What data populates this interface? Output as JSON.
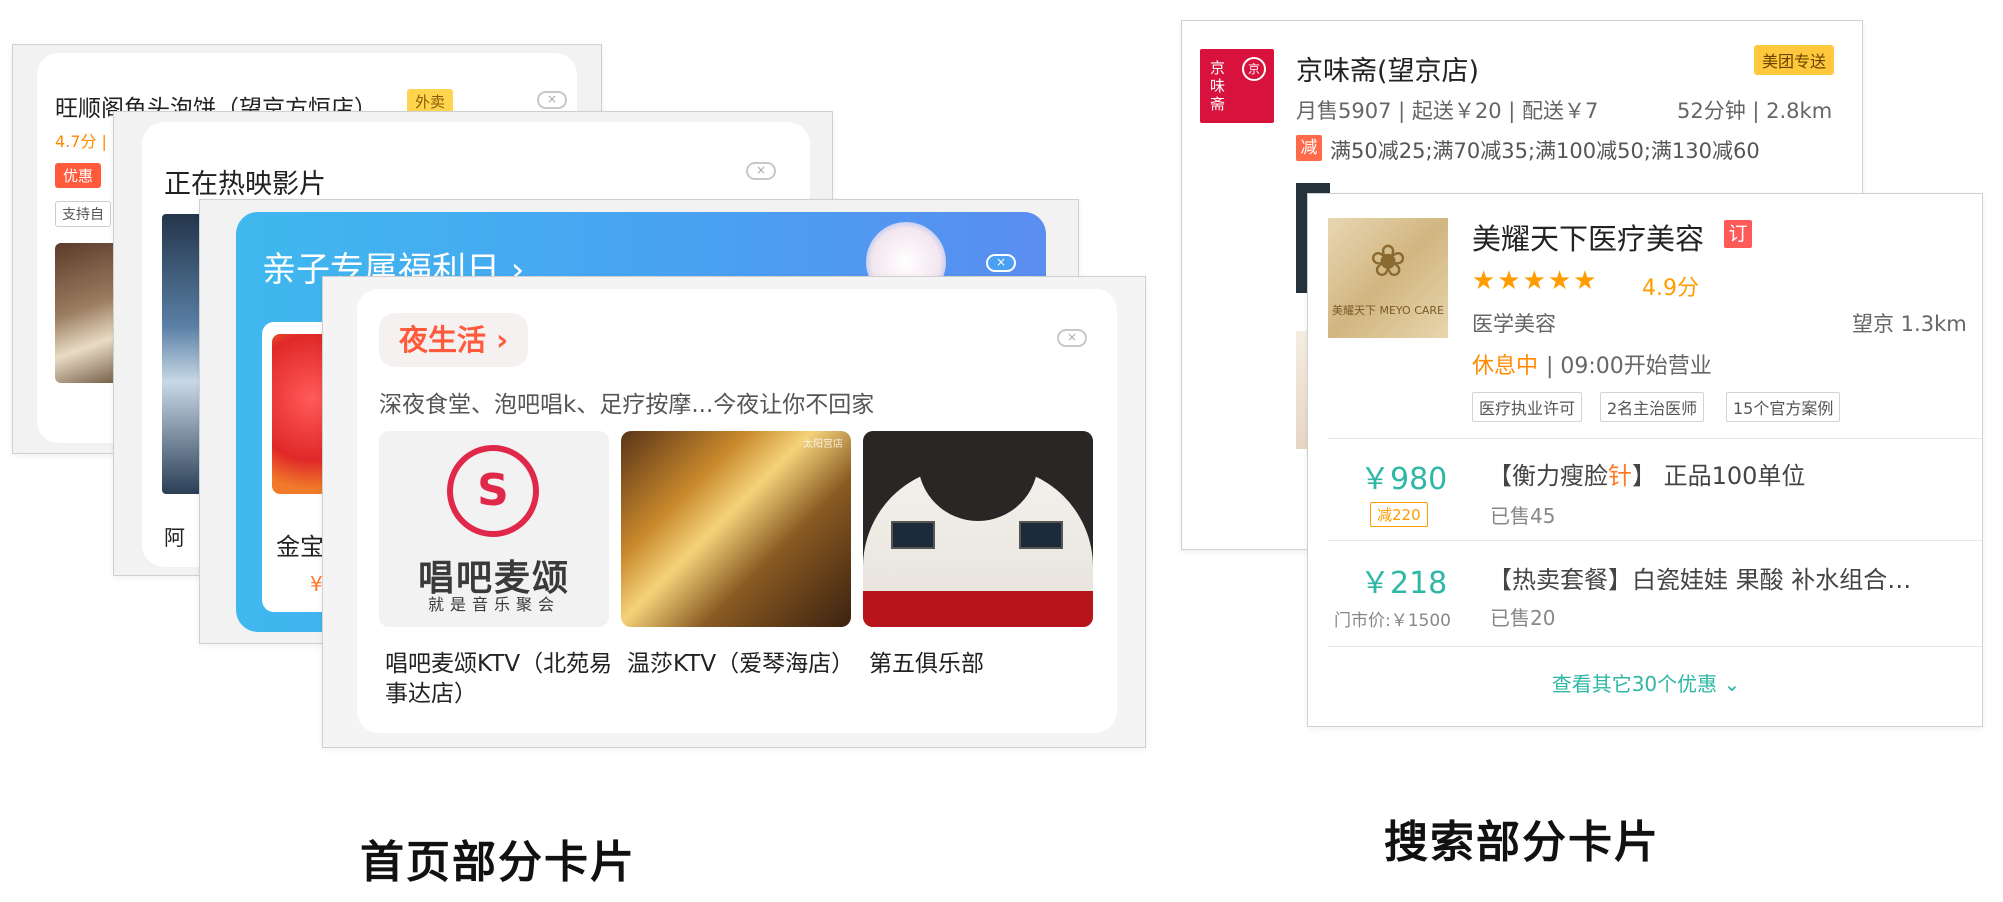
{
  "home_cards": {
    "takeout": {
      "title": "旺顺阁鱼头泡饼（望京方恒店）",
      "tag": "外卖",
      "rating": "4.7分 |",
      "promo_tag": "优惠",
      "pickup_tag": "支持自"
    },
    "movies": {
      "title": "正在热映影片",
      "movie_name": "阿"
    },
    "family": {
      "title": "亲子专属福利日 ›",
      "item_name": "金宝",
      "price_fragment": "¥"
    },
    "nightlife": {
      "badge": "夜生活 ›",
      "subtitle": "深夜食堂、泡吧唱k、足疗按摩...今夜让你不回家",
      "logo_brand": "唱吧麦颂",
      "logo_slogan": "就是音乐聚会",
      "photo_watermark": "太阳宫店",
      "venues": [
        {
          "name": "唱吧麦颂KTV（北苑易事达店）"
        },
        {
          "name": "温莎KTV（爱琴海店）"
        },
        {
          "name": "第五俱乐部"
        }
      ]
    }
  },
  "search_cards": {
    "restaurant": {
      "logo_text": "京味斋",
      "logo_mark": "京",
      "title": "京味斋(望京店)",
      "delivery_tag": "美团专送",
      "meta": "月售5907 | 起送￥20 | 配送￥7",
      "time_distance": "52分钟 | 2.8km",
      "discount_icon": "减",
      "discounts": "满50减25;满70减35;满100减50;满130减60"
    },
    "beauty": {
      "logo_text": "美耀天下 MEYO CARE",
      "title": "美耀天下医疗美容",
      "booking_icon": "订",
      "rating_stars": 5,
      "score": "4.9分",
      "category": "医学美容",
      "location": "望京 1.3km",
      "status": "休息中",
      "hours": "| 09:00开始营业",
      "badges": [
        "医疗执业许可",
        "2名主治医师",
        "15个官方案例"
      ],
      "deals": [
        {
          "price": "￥980",
          "cut_tag": "减220",
          "title_prefix": "【衡力瘦脸",
          "title_highlight": "针",
          "title_suffix": "】 正品100单位",
          "sold": "已售45"
        },
        {
          "price": "￥218",
          "original_price": "门市价:￥1500",
          "title": "【热卖套餐】白瓷娃娃 果酸 补水组合…",
          "sold": "已售20"
        }
      ],
      "more_link": "查看其它30个优惠"
    }
  },
  "captions": {
    "home": "首页部分卡片",
    "search": "搜索部分卡片"
  },
  "colors": {
    "accent_orange": "#ff5a3c",
    "teal": "#2fb7a5",
    "star": "#ff9c00"
  }
}
